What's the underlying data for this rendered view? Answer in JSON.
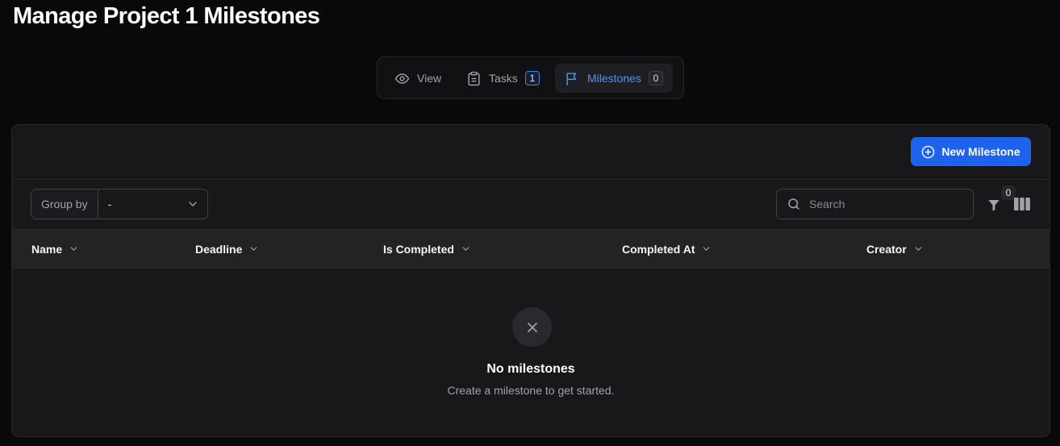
{
  "page": {
    "title": "Manage Project 1 Milestones"
  },
  "tabs": [
    {
      "label": "View",
      "icon": "eye-icon",
      "active": false
    },
    {
      "label": "Tasks",
      "icon": "clipboard-icon",
      "badge": "1",
      "active": false
    },
    {
      "label": "Milestones",
      "icon": "flag-icon",
      "badge": "0",
      "active": true
    }
  ],
  "toolbar": {
    "new_button": "New Milestone",
    "group_by_label": "Group by",
    "group_by_value": "-",
    "search_placeholder": "Search",
    "filter_count": "0"
  },
  "table": {
    "columns": [
      "Name",
      "Deadline",
      "Is Completed",
      "Completed At",
      "Creator"
    ]
  },
  "empty_state": {
    "title": "No milestones",
    "subtitle": "Create a milestone to get started."
  },
  "colors": {
    "background": "#09090b",
    "card": "#18181b",
    "accent": "#1d63ed",
    "active_tab_text": "#4d95f7"
  }
}
